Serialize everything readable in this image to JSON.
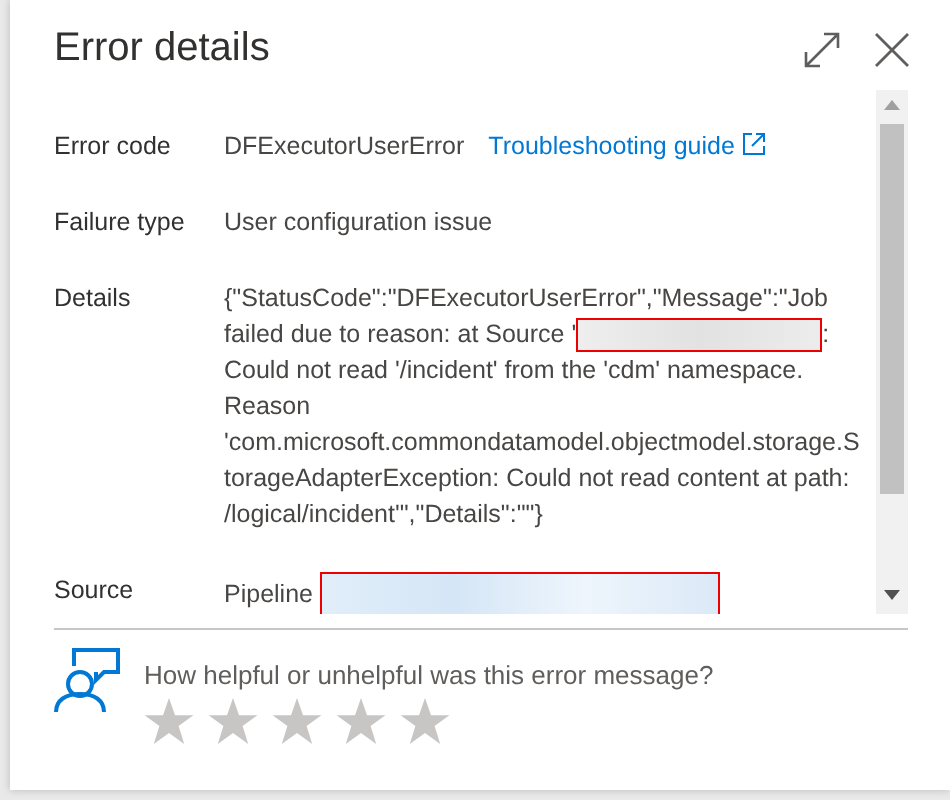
{
  "panel": {
    "title": "Error details"
  },
  "fields": [
    {
      "label": "Error code",
      "value": "DFExecutorUserError",
      "link": "Troubleshooting guide"
    },
    {
      "label": "Failure type",
      "value": "User configuration issue"
    },
    {
      "label": "Details",
      "segments": [
        {
          "kind": "text",
          "text": "{\"StatusCode\":\"DFExecutorUserError\",\"Message\":\"Job failed due to reason: at Source '"
        },
        {
          "kind": "redacted"
        },
        {
          "kind": "text",
          "text": ": Could not read '/incident' from the 'cdm' namespace. Reason 'com.microsoft.commondatamodel.objectmodel.storage.StorageAdapterException: Could not read content at path: /logical/incident'\",\"Details\":\"\"}"
        }
      ]
    },
    {
      "label": "Source",
      "segments": [
        {
          "kind": "text",
          "text": "Pipeline "
        },
        {
          "kind": "redacted"
        }
      ]
    }
  ],
  "feedback": {
    "question": "How helpful or unhelpful was this error message?",
    "stars": 0
  }
}
